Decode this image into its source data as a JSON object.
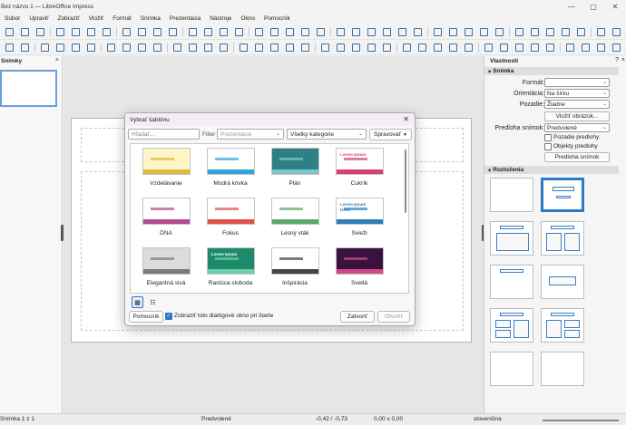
{
  "window": {
    "title": "Bez názvu 1 — LibreOffice Impress"
  },
  "menu": [
    "Súbor",
    "Upraviť",
    "Zobraziť",
    "Vložiť",
    "Formát",
    "Snímka",
    "Prezentácia",
    "Nástroje",
    "Okno",
    "Pomocník"
  ],
  "left_pane": {
    "title": "Snímky",
    "close": "×"
  },
  "sidebar": {
    "title": "Vlastnosti",
    "section_slide": "Snímka",
    "format_label": "Formát:",
    "format_value": "",
    "orientation_label": "Orientácia:",
    "orientation_value": "Na šírku",
    "background_label": "Pozadie:",
    "background_value": "Žiadne",
    "insert_image": "Vložiť obrázok...",
    "master_label": "Predloha snímok:",
    "master_value": "Predvolené",
    "master_bg": "Pozadie predlohy",
    "master_obj": "Objekty predlohy",
    "master_btn": "Predloha snímok",
    "section_layouts": "Rozloženia"
  },
  "dialog": {
    "title": "Vybrať šablónu",
    "search_placeholder": "Hľadať...",
    "filter_label": "Filter",
    "filter_value": "Prezentácie",
    "category_value": "Všetky kategórie",
    "manage_label": "Spravovať",
    "templates": [
      {
        "name": "Vzdelávanie",
        "bg": "#fdf6c9",
        "accent": "#e0b940"
      },
      {
        "name": "Modrá krivka",
        "bg": "#ffffff",
        "accent": "#2ea6d9"
      },
      {
        "name": "Plán",
        "bg": "#2e7f86",
        "accent": "#7ec6c6"
      },
      {
        "name": "Cukrík",
        "bg": "#ffffff",
        "accent": "#d8407a"
      },
      {
        "name": "DNA",
        "bg": "#ffffff",
        "accent": "#b64a8f"
      },
      {
        "name": "Fokus",
        "bg": "#ffffff",
        "accent": "#e0504a"
      },
      {
        "name": "Lesný vták",
        "bg": "#ffffff",
        "accent": "#5ba86a"
      },
      {
        "name": "Svieži",
        "bg": "#ffffff",
        "accent": "#2f7fbd"
      },
      {
        "name": "Elegantná sivá",
        "bg": "#dcdcdc",
        "accent": "#7a7a7a"
      },
      {
        "name": "Rastúca sloboda",
        "bg": "#1d8a6c",
        "accent": "#6fd0a8"
      },
      {
        "name": "Inšpirácia",
        "bg": "#ffffff",
        "accent": "#444444"
      },
      {
        "name": "Svetlá",
        "bg": "#3a1240",
        "accent": "#d04a8a"
      }
    ],
    "thumb_texts": {
      "lorem": "Lorem Ipsum",
      "dolor": "Dolor"
    },
    "help_label": "Pomocník",
    "show_at_startup": "Zobraziť toto dialógové okno pri štarte",
    "close_label": "Zatvoriť",
    "open_label": "Otvoriť"
  },
  "status": {
    "slide": "Snímka 1 z 1",
    "master": "Predvolené",
    "position": "-0,42 / -0,73",
    "size": "0,00 x 0,00",
    "language": "slovenčina"
  },
  "colors": {
    "accent": "#2a78c8",
    "selection": "#6aa0d8"
  }
}
